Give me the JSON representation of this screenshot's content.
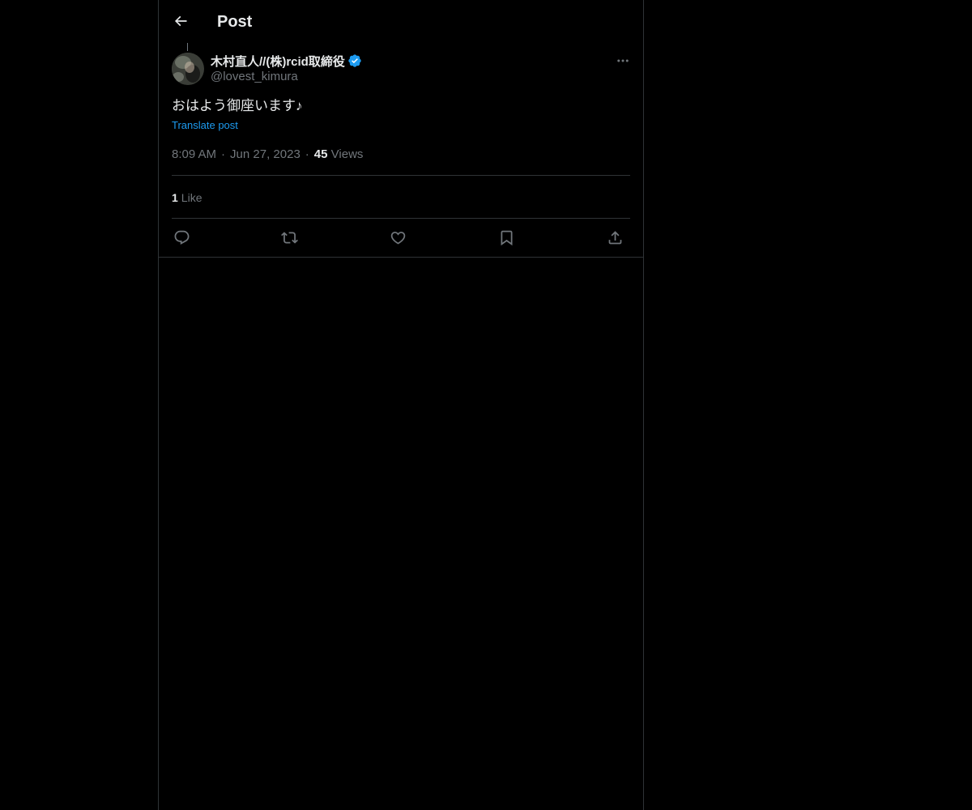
{
  "header": {
    "title": "Post",
    "back_icon": "arrow-left-icon"
  },
  "post": {
    "author": {
      "display_name": "木村直人//(株)rcid取締役",
      "handle": "@lovest_kimura",
      "verified": true,
      "verified_color": "#1d9bf0"
    },
    "text": "おはよう御座います♪",
    "translate_label": "Translate post",
    "time": "8:09 AM",
    "date": "Jun 27, 2023",
    "views_count": "45",
    "views_label": "Views",
    "likes_count": "1",
    "likes_label": "Like",
    "separator": "·"
  },
  "actions": [
    {
      "name": "reply",
      "icon": "reply-icon"
    },
    {
      "name": "repost",
      "icon": "repost-icon"
    },
    {
      "name": "like",
      "icon": "heart-icon"
    },
    {
      "name": "bookmark",
      "icon": "bookmark-icon"
    },
    {
      "name": "share",
      "icon": "share-icon"
    }
  ],
  "colors": {
    "background": "#000000",
    "text_primary": "#e7e9ea",
    "text_secondary": "#71767b",
    "link": "#1d9bf0",
    "border": "#2f3336"
  }
}
